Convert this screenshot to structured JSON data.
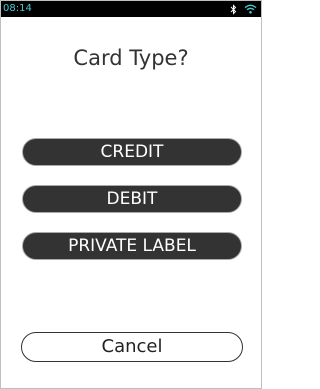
{
  "status_bar": {
    "time": "08:14",
    "icons": [
      "bluetooth-icon",
      "wifi-icon"
    ],
    "time_color": "#48c8d0"
  },
  "prompt": {
    "title": "Card Type?"
  },
  "options": {
    "credit_label": "CREDIT",
    "debit_label": "DEBIT",
    "private_label": "PRIVATE LABEL"
  },
  "actions": {
    "cancel_label": "Cancel"
  },
  "colors": {
    "button_fill": "#333333",
    "background": "#ffffff",
    "status_bar": "#000000"
  }
}
